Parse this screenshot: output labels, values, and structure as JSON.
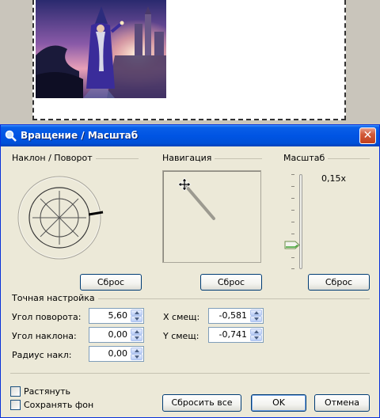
{
  "dialog": {
    "title": "Вращение / Масштаб",
    "close_label": "✕"
  },
  "groups": {
    "tilt_rotate": "Наклон / Поворот",
    "navigation": "Навигация",
    "scale": "Масштаб",
    "fine_tune": "Точная настройка"
  },
  "scale": {
    "value_text": "0,15x",
    "level": 0.15
  },
  "buttons": {
    "reset_rotate": "Сброс",
    "reset_nav": "Сброс",
    "reset_scale": "Сброс",
    "reset_all": "Сбросить все",
    "ok": "OK",
    "cancel": "Отмена"
  },
  "fields": {
    "rotation_angle": {
      "label": "Угол поворота:",
      "value": "5,60"
    },
    "tilt_angle": {
      "label": "Угол наклона:",
      "value": "0,00"
    },
    "tilt_radius": {
      "label": "Радиус накл:",
      "value": "0,00"
    },
    "x_offset": {
      "label": "X смещ:",
      "value": "-0,581"
    },
    "y_offset": {
      "label": "Y смещ:",
      "value": "-0,741"
    }
  },
  "checkboxes": {
    "stretch": {
      "label": "Растянуть",
      "checked": false
    },
    "keep_background": {
      "label": "Сохранять фон",
      "checked": false
    }
  },
  "icons": {
    "title_icon": "magnifier-icon",
    "nav_cursor": "move-cursor-icon"
  },
  "colors": {
    "titlebar": "#0054e3",
    "dialog_bg": "#ece9d8",
    "close_button": "#d25a3a"
  }
}
